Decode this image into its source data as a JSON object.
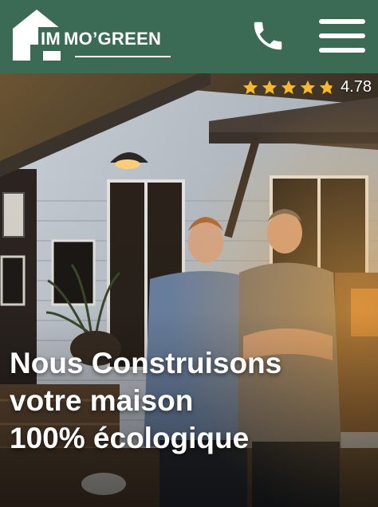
{
  "brand": {
    "logo_prefix": "IM",
    "logo_rest": "MO’GREEN",
    "color": "#3c6b55"
  },
  "header": {
    "phone_icon": "phone-icon",
    "menu_icon": "hamburger-menu-icon"
  },
  "rating": {
    "stars": 4.78,
    "value": "4.78"
  },
  "hero": {
    "headline_line1": "Nous Construisons",
    "headline_line2": "votre maison",
    "headline_line3": "100% écologique"
  }
}
